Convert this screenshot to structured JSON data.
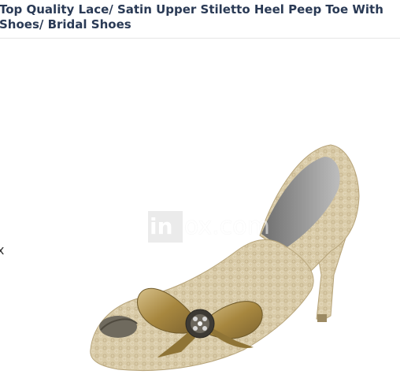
{
  "product": {
    "title": "Top Quality Lace/ Satin Upper Stiletto Heel Peep Toe With Shoes/ Bridal Shoes",
    "title_line1": "Top Quality Lace/ Satin Upper Stiletto Heel Peep Toe With",
    "title_line2": "Shoes/ Bridal Shoes"
  },
  "watermark": {
    "logo": "in",
    "text": "ox.com"
  },
  "gallery": {
    "prev_icon": "chevron-left-icon",
    "prev_label": "x"
  },
  "colors": {
    "title": "#2a3a55",
    "lace": "#d8c9a6",
    "satin": "#a88a4a",
    "inner": "#8a8a8a"
  }
}
